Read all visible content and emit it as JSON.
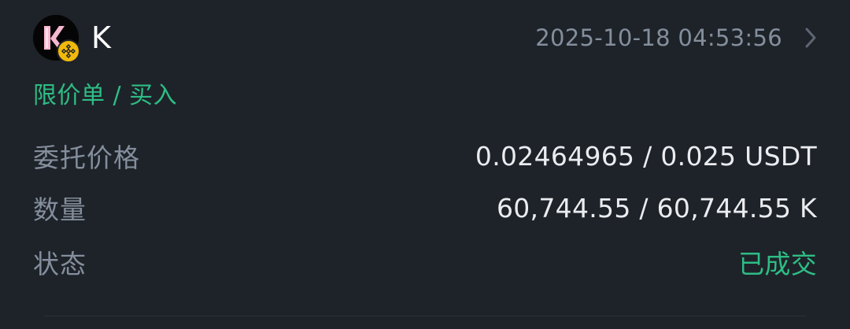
{
  "order": {
    "symbol": "K",
    "timestamp": "2025-10-18 04:53:56",
    "type_label": "限价单 / 买入",
    "details": [
      {
        "label": "委托价格",
        "value": "0.02464965 / 0.025 USDT"
      },
      {
        "label": "数量",
        "value": "60,744.55 / 60,744.55 K"
      },
      {
        "label": "状态",
        "value": "已成交"
      }
    ]
  },
  "icons": {
    "token": "token-logo-icon",
    "chain": "bnb-chain-badge-icon",
    "navigate": "chevron-right-icon"
  },
  "colors": {
    "background": "#1e2329",
    "buy": "#2ebd85",
    "muted_text": "#848e9c",
    "primary_text": "#eaecef",
    "chain_badge": "#f0b90b"
  }
}
